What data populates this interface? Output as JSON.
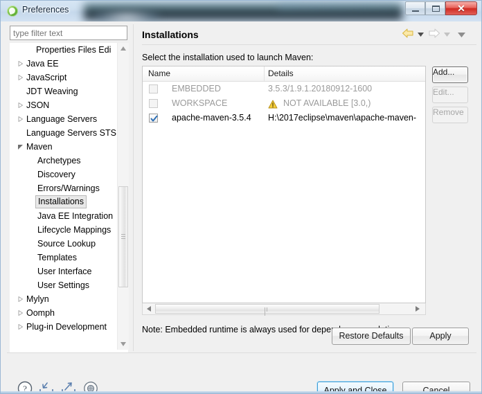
{
  "window": {
    "title": "Preferences",
    "icon": "eclipse-logo-icon",
    "controls": {
      "minimize": "–",
      "maximize": "□",
      "close": "✕"
    }
  },
  "sidebar": {
    "filter": {
      "value": "",
      "placeholder": "type filter text"
    },
    "tree": [
      {
        "label": "Properties Files Edi",
        "indent": 38,
        "arrow": "none",
        "selected": false
      },
      {
        "label": "Java EE",
        "indent": 24,
        "arrow": "collapsed",
        "selected": false
      },
      {
        "label": "JavaScript",
        "indent": 24,
        "arrow": "collapsed",
        "selected": false
      },
      {
        "label": "JDT Weaving",
        "indent": 24,
        "arrow": "none",
        "selected": false
      },
      {
        "label": "JSON",
        "indent": 24,
        "arrow": "collapsed",
        "selected": false
      },
      {
        "label": "Language Servers",
        "indent": 24,
        "arrow": "collapsed",
        "selected": false
      },
      {
        "label": "Language Servers STS",
        "indent": 24,
        "arrow": "none",
        "selected": false
      },
      {
        "label": "Maven",
        "indent": 24,
        "arrow": "expanded",
        "selected": false
      },
      {
        "label": "Archetypes",
        "indent": 40,
        "arrow": "none",
        "selected": false
      },
      {
        "label": "Discovery",
        "indent": 40,
        "arrow": "none",
        "selected": false
      },
      {
        "label": "Errors/Warnings",
        "indent": 40,
        "arrow": "none",
        "selected": false
      },
      {
        "label": "Installations",
        "indent": 40,
        "arrow": "none",
        "selected": true
      },
      {
        "label": "Java EE Integration",
        "indent": 40,
        "arrow": "none",
        "selected": false
      },
      {
        "label": "Lifecycle Mappings",
        "indent": 40,
        "arrow": "none",
        "selected": false
      },
      {
        "label": "Source Lookup",
        "indent": 40,
        "arrow": "none",
        "selected": false
      },
      {
        "label": "Templates",
        "indent": 40,
        "arrow": "none",
        "selected": false
      },
      {
        "label": "User Interface",
        "indent": 40,
        "arrow": "none",
        "selected": false
      },
      {
        "label": "User Settings",
        "indent": 40,
        "arrow": "none",
        "selected": false
      },
      {
        "label": "Mylyn",
        "indent": 24,
        "arrow": "collapsed",
        "selected": false
      },
      {
        "label": "Oomph",
        "indent": 24,
        "arrow": "collapsed",
        "selected": false
      },
      {
        "label": "Plug-in Development",
        "indent": 24,
        "arrow": "collapsed",
        "selected": false
      }
    ]
  },
  "page": {
    "title": "Installations",
    "select_label": "Select the installation used to launch Maven:",
    "note": "Note: Embedded runtime is always used for dependency resolution",
    "nav": {
      "back_icon": "back-arrow-icon",
      "back_menu_icon": "chevron-down-icon",
      "forward_icon": "forward-arrow-icon",
      "forward_menu_icon": "chevron-down-icon",
      "page_menu_icon": "chevron-down-icon"
    }
  },
  "table": {
    "columns": [
      "Name",
      "Details"
    ],
    "rows": [
      {
        "checked": false,
        "enabled": false,
        "name": "EMBEDDED",
        "details": "3.5.3/1.9.1.20180912-1600",
        "warning": false
      },
      {
        "checked": false,
        "enabled": false,
        "name": "WORKSPACE",
        "details": "NOT AVAILABLE [3.0,)",
        "warning": true,
        "warning_icon": "warning-triangle-icon"
      },
      {
        "checked": true,
        "enabled": true,
        "name": "apache-maven-3.5.4",
        "details": "H:\\2017eclipse\\maven\\apache-maven-",
        "warning": false
      }
    ]
  },
  "side_buttons": [
    {
      "label": "Add...",
      "enabled": true
    },
    {
      "label": "Edit...",
      "enabled": false
    },
    {
      "label": "Remove",
      "enabled": false
    }
  ],
  "page_buttons": {
    "restore_defaults": "Restore Defaults",
    "apply": "Apply"
  },
  "footer": {
    "icons": [
      {
        "name": "help-icon"
      },
      {
        "name": "import-icon"
      },
      {
        "name": "export-icon"
      },
      {
        "name": "oomph-recorder-icon"
      }
    ],
    "apply_and_close": "Apply and Close",
    "cancel": "Cancel"
  },
  "colors": {
    "accent": "#3c9bd4",
    "close_button": "#cf2a22",
    "warning": "#f0c419",
    "selection_bg": "#e8e8e8"
  }
}
